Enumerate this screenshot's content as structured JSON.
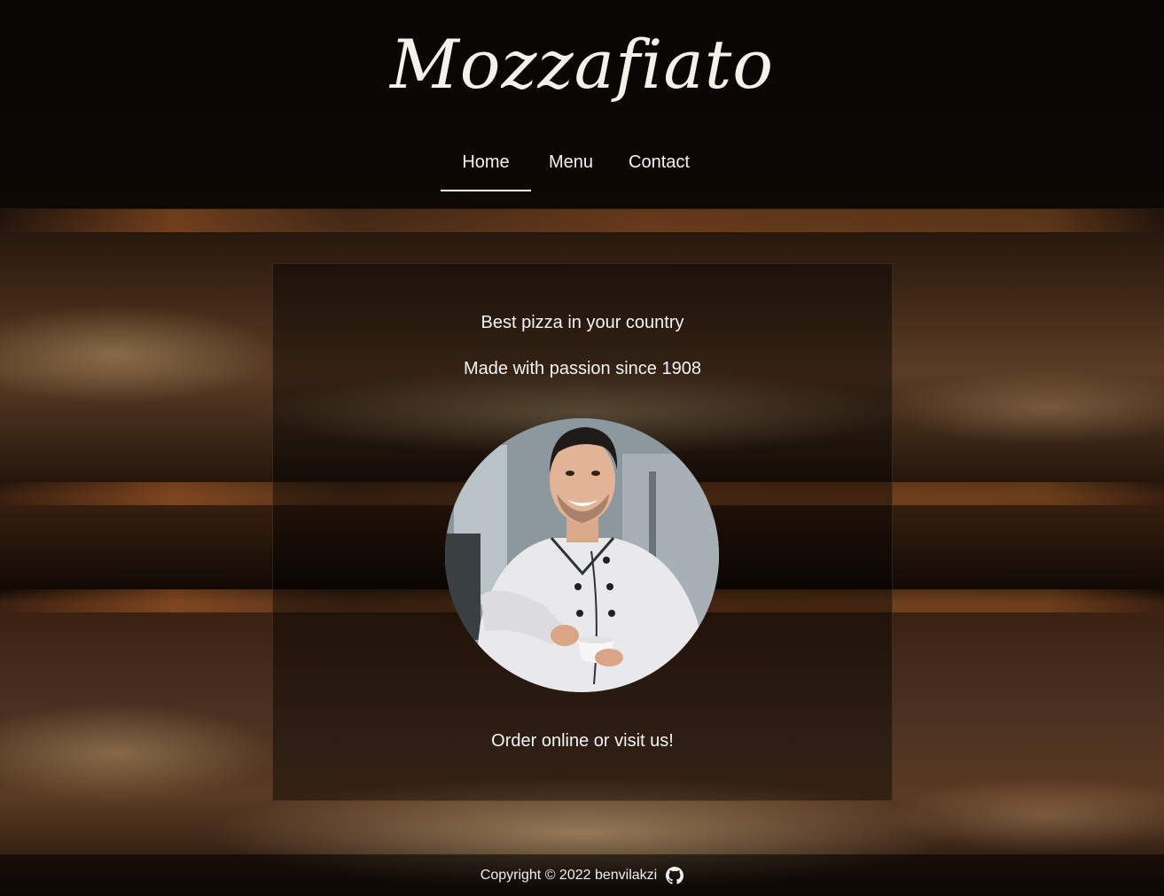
{
  "brand": {
    "name": "Mozzafiato"
  },
  "nav": {
    "items": [
      {
        "label": "Home",
        "active": true
      },
      {
        "label": "Menu",
        "active": false
      },
      {
        "label": "Contact",
        "active": false
      }
    ]
  },
  "hero": {
    "tagline": "Best pizza in your country",
    "subline": "Made with passion since 1908",
    "cta_text": "Order online or visit us!",
    "image_subject": "smiling chef holding a cup"
  },
  "footer": {
    "copyright": "Copyright © 2022 benvilakzi",
    "icon": "github-icon"
  },
  "colors": {
    "text": "#f4f4f4",
    "overlay": "#000000",
    "active_underline": "#ffffff"
  }
}
